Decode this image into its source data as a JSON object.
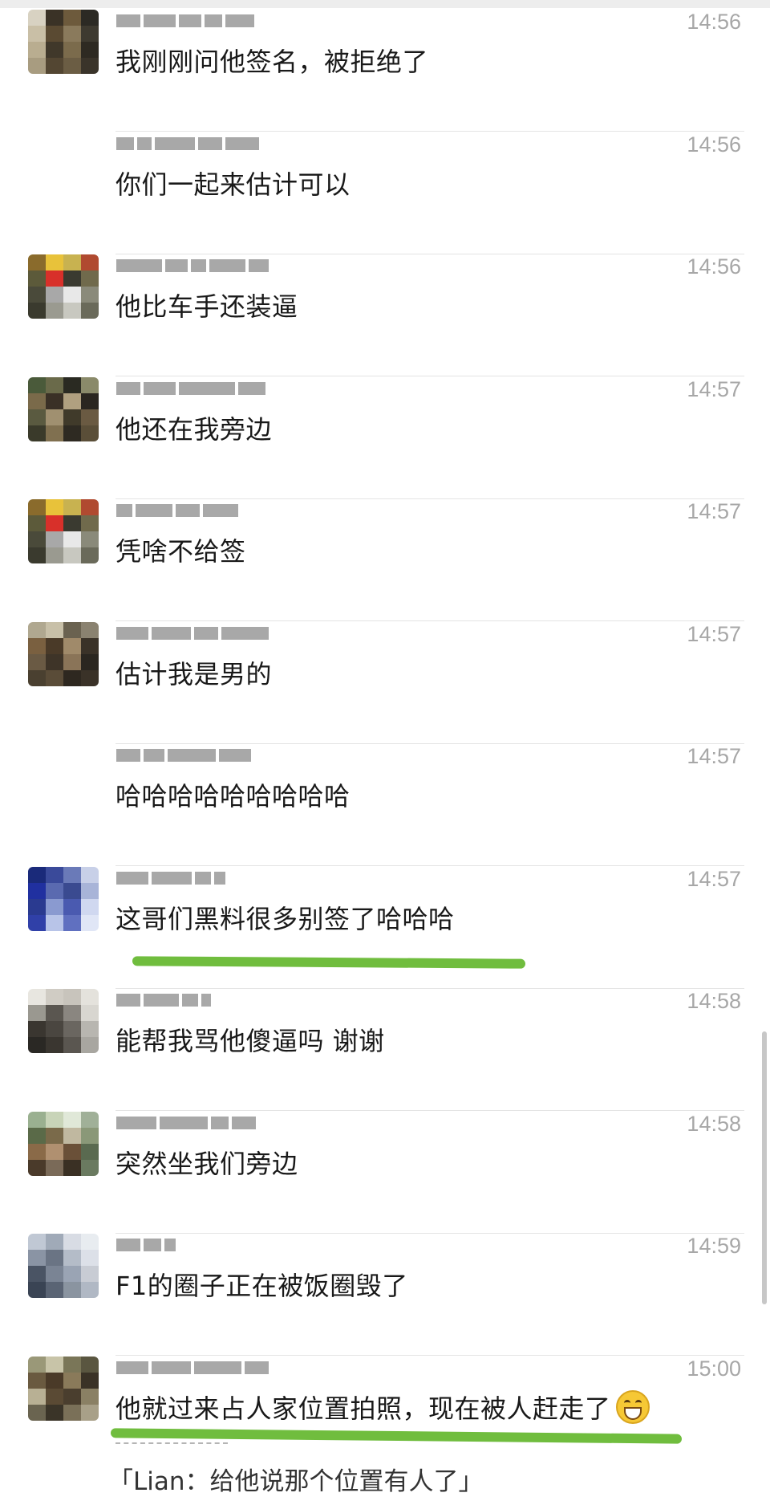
{
  "messages": [
    {
      "time": "14:56",
      "text": "我刚刚问他签名，被拒绝了",
      "avatar_colors": [
        "#d8d2c2",
        "#3a3226",
        "#6d5a3c",
        "#2c2a24",
        "#c9bfa6",
        "#5a4a32",
        "#8a7a5c",
        "#3e3a30",
        "#b9ad90",
        "#40382a",
        "#7b6b4c",
        "#2e2a22",
        "#a89c80",
        "#534632",
        "#6b5d44",
        "#3a342a"
      ]
    },
    {
      "time": "14:56",
      "text": "你们一起来估计可以",
      "avatar_colors": null
    },
    {
      "time": "14:56",
      "text": "他比车手还装逼",
      "avatar_colors": [
        "#8a6b2c",
        "#e8c23a",
        "#c8b250",
        "#b04a30",
        "#5c5a3a",
        "#d8302a",
        "#3a3a30",
        "#706a4c",
        "#4a4a3a",
        "#a8a8a8",
        "#e8e8e8",
        "#8a8a7a",
        "#3a3a2e",
        "#9a9a90",
        "#c8c8c0",
        "#6a6a5a"
      ]
    },
    {
      "time": "14:57",
      "text": "他还在我旁边",
      "avatar_colors": [
        "#4a5a3a",
        "#6a6a4a",
        "#2a2a22",
        "#8a8a6a",
        "#7a6a4a",
        "#3a3026",
        "#b0a080",
        "#2a2620",
        "#5a5a40",
        "#a09070",
        "#403a2a",
        "#6a5a42",
        "#3a3a2a",
        "#807050",
        "#2e2a22",
        "#5a4e38"
      ]
    },
    {
      "time": "14:57",
      "text": "凭啥不给签",
      "avatar_colors": [
        "#8a6b2c",
        "#e8c23a",
        "#c8b250",
        "#b04a30",
        "#5c5a3a",
        "#d8302a",
        "#3a3a30",
        "#706a4c",
        "#4a4a3a",
        "#a8a8a8",
        "#e8e8e8",
        "#8a8a7a",
        "#3a3a2e",
        "#9a9a90",
        "#c8c8c0",
        "#6a6a5a"
      ]
    },
    {
      "time": "14:57",
      "text": "估计我是男的",
      "avatar_colors": [
        "#b0a890",
        "#c8c0a8",
        "#6a6250",
        "#8a8270",
        "#7a6040",
        "#4a3a28",
        "#a08a6a",
        "#3a3228",
        "#6a5a44",
        "#3e3428",
        "#8a7458",
        "#2a2620",
        "#4a4030",
        "#5a4c38",
        "#2e2820",
        "#3a3228"
      ]
    },
    {
      "time": "14:57",
      "text": "哈哈哈哈哈哈哈哈哈",
      "avatar_colors": null
    },
    {
      "time": "14:57",
      "text": "这哥们黑料很多别签了哈哈哈",
      "avatar_colors": [
        "#1a2a7a",
        "#3a4a9a",
        "#6a7ab8",
        "#c8d0e8",
        "#2030a0",
        "#5a6ab0",
        "#3a4a90",
        "#a8b4d8",
        "#2a3a90",
        "#8a9ad0",
        "#4a5ab0",
        "#d0d8f0",
        "#3040a8",
        "#b8c4e8",
        "#6070c0",
        "#e0e6f6"
      ]
    },
    {
      "time": "14:58",
      "text": "能帮我骂他傻逼吗 谢谢",
      "avatar_colors": [
        "#e8e6e0",
        "#d0ccc4",
        "#c8c4bc",
        "#e4e2dc",
        "#9a9890",
        "#5a5650",
        "#8a8680",
        "#d8d6d0",
        "#3a3630",
        "#4a4640",
        "#6a6660",
        "#b8b6b0",
        "#2a2824",
        "#3a3630",
        "#5a5650",
        "#a8a6a0"
      ]
    },
    {
      "time": "14:58",
      "text": "突然坐我们旁边",
      "avatar_colors": [
        "#9ab090",
        "#c8d4b8",
        "#e0e8d8",
        "#a0b098",
        "#5a6a48",
        "#7a6a4a",
        "#c0b8a0",
        "#8a9878",
        "#8a6a48",
        "#b09070",
        "#6a5038",
        "#5a6a50",
        "#4a3a2a",
        "#7a6a58",
        "#3a3024",
        "#6a7a60"
      ]
    },
    {
      "time": "14:59",
      "text": "F1的圈子正在被饭圈毁了",
      "avatar_colors": [
        "#c0c8d4",
        "#a0aab8",
        "#d8dce4",
        "#e8ecf0",
        "#8a94a4",
        "#6a7484",
        "#b4bcc8",
        "#dce0e8",
        "#4a5464",
        "#7a8494",
        "#9aa4b4",
        "#c8ccd4",
        "#3a4454",
        "#5a6474",
        "#8a94a0",
        "#b0b8c4"
      ]
    },
    {
      "time": "15:00",
      "text": "他就过来占人家位置拍照，现在被人赶走了",
      "avatar_colors": [
        "#9a9878",
        "#c8c4a8",
        "#7a7658",
        "#5a5640",
        "#6a5a40",
        "#4a3a28",
        "#8a7a5a",
        "#3a3226",
        "#b8b094",
        "#5a4a34",
        "#4a3e2e",
        "#8a8064",
        "#6a6450",
        "#3a3428",
        "#7a7058",
        "#a8a088"
      ]
    }
  ],
  "quote_text": "「Lian：给他说那个位置有人了」"
}
